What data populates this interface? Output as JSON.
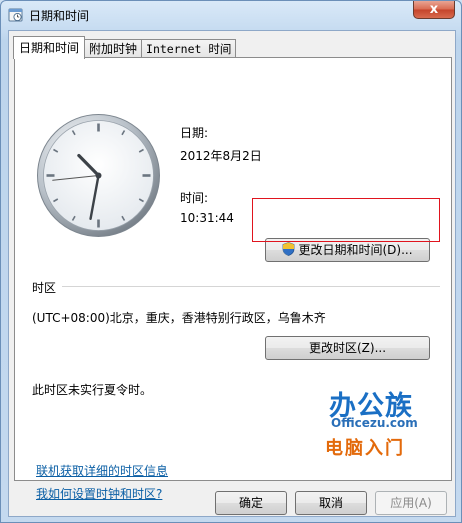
{
  "window": {
    "title": "日期和时间",
    "close_label": "x"
  },
  "tabs": [
    {
      "label": "日期和时间",
      "active": true
    },
    {
      "label": "附加时钟",
      "active": false
    },
    {
      "label": "Internet 时间",
      "active": false
    }
  ],
  "date_time": {
    "date_label": "日期:",
    "date_value": "2012年8月2日",
    "time_label": "时间:",
    "time_value": "10:31:44",
    "change_button": "更改日期和时间(D)..."
  },
  "timezone": {
    "section_label": "时区",
    "value": "(UTC+08:00)北京，重庆，香港特别行政区，乌鲁木齐",
    "change_button": "更改时区(Z)...",
    "dst_note": "此时区未实行夏令时。"
  },
  "links": {
    "online_info": "联机获取详细的时区信息",
    "how_to": "我如何设置时钟和时区?"
  },
  "watermark": {
    "brand": "办公族",
    "domain": "Officezu.com",
    "tagline": "电脑入门"
  },
  "footer": {
    "ok": "确定",
    "cancel": "取消",
    "apply": "应用(A)"
  },
  "colors": {
    "link": "#0b5fa5",
    "highlight_border": "#e0141e"
  },
  "clock": {
    "hour": 10,
    "minute": 31,
    "second": 44
  }
}
